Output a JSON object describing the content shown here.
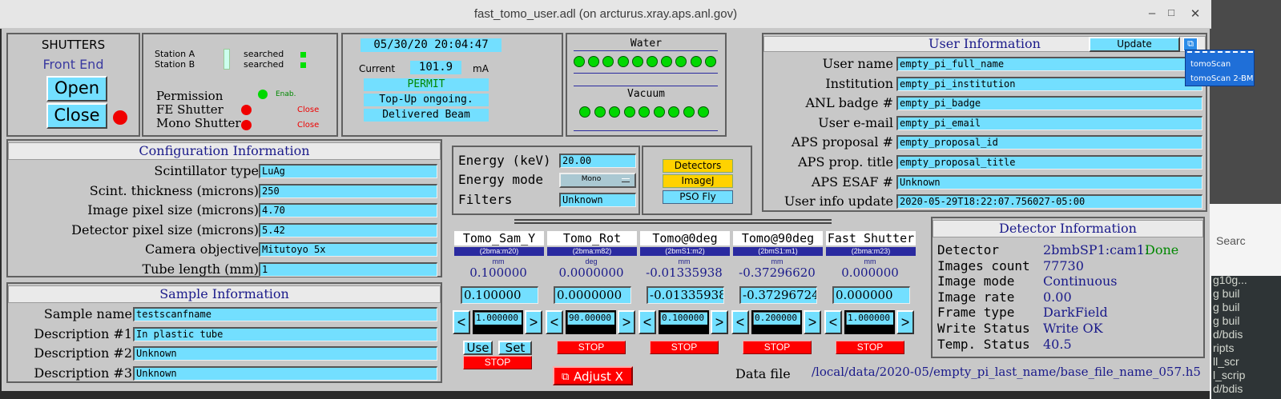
{
  "window": {
    "title": "fast_tomo_user.adl (on arcturus.xray.aps.anl.gov)",
    "min_icon": "–",
    "max_icon": "□",
    "close_icon": "✕"
  },
  "background": {
    "search_label": "Searc",
    "terminal_lines": [
      "g10g...",
      "g buil",
      "g buil",
      "g buil",
      "d/bdis",
      "ripts",
      "ll_scr",
      "l_scrip",
      "d/bdis"
    ]
  },
  "shutters": {
    "title": "SHUTTERS",
    "subtitle": "Front End",
    "open_label": "Open",
    "close_label": "Close"
  },
  "stations": {
    "station_a": "Station A",
    "station_b": "Station B",
    "status_a": "searched",
    "status_b": "searched",
    "permission": "Permission",
    "fe_shutter": "FE  Shutter",
    "mono_shutter": "Mono Shutter",
    "perm_status": "Enab.",
    "fe_status": "Close",
    "mono_status": "Close"
  },
  "beam": {
    "datetime": "05/30/20 20:04:47",
    "current_label": "Current",
    "current_value": "101.9",
    "current_unit": "mA",
    "permit": "PERMIT",
    "topup": "Top-Up ongoing.",
    "delivered": "Delivered Beam"
  },
  "water": {
    "label": "Water",
    "vacuum_label": "Vacuum"
  },
  "user_info": {
    "title": "User Information",
    "update_label": "Update",
    "menu": [
      "tomoScan",
      "tomoScan 2-BM"
    ],
    "fields": [
      {
        "label": "User name",
        "value": "empty_pi_full_name"
      },
      {
        "label": "Institution",
        "value": "empty_pi_institution"
      },
      {
        "label": "ANL badge #",
        "value": "empty_pi_badge"
      },
      {
        "label": "User e-mail",
        "value": "empty_pi_email"
      },
      {
        "label": "APS proposal #",
        "value": "empty_proposal_id"
      },
      {
        "label": "APS prop. title",
        "value": "empty_proposal_title"
      },
      {
        "label": "APS ESAF #",
        "value": "Unknown"
      },
      {
        "label": "User info update",
        "value": "2020-05-29T18:22:07.756027-05:00"
      }
    ]
  },
  "config": {
    "title": "Configuration Information",
    "fields": [
      {
        "label": "Scintillator type",
        "value": "LuAg"
      },
      {
        "label": "Scint. thickness (microns)",
        "value": "250"
      },
      {
        "label": "Image pixel size (microns)",
        "value": "4.70"
      },
      {
        "label": "Detector pixel size (microns)",
        "value": "5.42"
      },
      {
        "label": "Camera objective",
        "value": "Mitutoyo 5x"
      },
      {
        "label": "Tube length (mm)",
        "value": "1"
      }
    ]
  },
  "sample": {
    "title": "Sample Information",
    "fields": [
      {
        "label": "Sample name",
        "value": "testscanfname"
      },
      {
        "label": "Description #1",
        "value": "In plastic tube"
      },
      {
        "label": "Description #2",
        "value": "Unknown"
      },
      {
        "label": "Description #3",
        "value": "Unknown"
      }
    ]
  },
  "energy": {
    "energy_label": "Energy (keV)",
    "energy_value": "20.00",
    "mode_label": "Energy mode",
    "mode_value": "Mono",
    "filters_label": "Filters",
    "filters_value": "Unknown"
  },
  "tools": {
    "detectors": "Detectors",
    "imagej": "ImageJ",
    "pso": "PSO Fly"
  },
  "motors": [
    {
      "title": "Tomo_Sam_Y",
      "pv": "(2bma:m20)",
      "unit": "mm",
      "readback": "0.100000",
      "setpoint": "0.100000",
      "tweak": "1.000000",
      "stop": "STOP"
    },
    {
      "title": "Tomo_Rot",
      "pv": "(2bma:m82)",
      "unit": "deg",
      "readback": "0.0000000",
      "setpoint": "0.0000000",
      "tweak": "90.00000",
      "stop": "STOP"
    },
    {
      "title": "Tomo@0deg",
      "pv": "(2bmS1:m2)",
      "unit": "mm",
      "readback": "-0.01335938",
      "setpoint": "-0.01335938",
      "tweak": "0.100000",
      "stop": "STOP"
    },
    {
      "title": "Tomo@90deg",
      "pv": "(2bmS1:m1)",
      "unit": "mm",
      "readback": "-0.37296620",
      "setpoint": "-0.37296724",
      "tweak": "0.200000",
      "stop": "STOP"
    },
    {
      "title": "Fast Shutter",
      "pv": "(2bma:m23)",
      "unit": "mm",
      "readback": "0.000000",
      "setpoint": "0.000000",
      "tweak": "1.000000",
      "stop": "STOP"
    }
  ],
  "motor_extra": {
    "use": "Use",
    "set": "Set",
    "stop": "STOP",
    "adjust": "Adjust X",
    "arrow_left": "<",
    "arrow_right": ">"
  },
  "detector": {
    "title": "Detector Information",
    "rows": [
      {
        "label": "Detector",
        "value": "2bmbSP1:cam1:"
      },
      {
        "label": "Images count",
        "value": "77730"
      },
      {
        "label": "Image mode",
        "value": "Continuous"
      },
      {
        "label": "Image rate",
        "value": "0.00"
      },
      {
        "label": "Frame type",
        "value": "DarkField"
      },
      {
        "label": "Write Status",
        "value": "Write OK"
      },
      {
        "label": "Temp. Status",
        "value": "40.5"
      }
    ],
    "done": "Done"
  },
  "datafile": {
    "label": "Data file",
    "value": "/local/data/2020-05/empty_pi_last_name/base_file_name_057.h5"
  },
  "colors": {
    "entry": "#73dfff",
    "panel": "#c8c8c8",
    "label_blue": "#1a1a8a",
    "led_green": "#00d800",
    "alarm_red": "#ff0000"
  }
}
